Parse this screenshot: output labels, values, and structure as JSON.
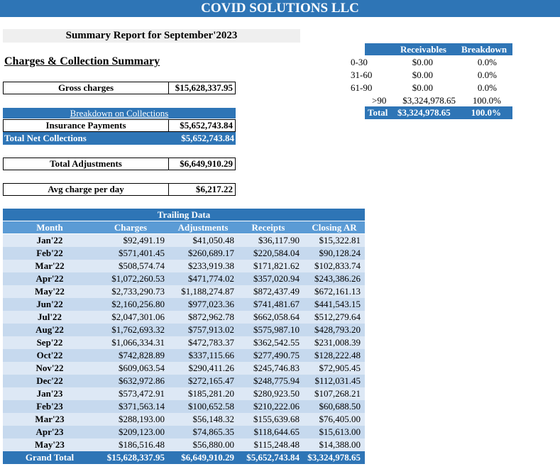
{
  "header": {
    "company": "COVID SOLUTIONS LLC"
  },
  "report_title": "Summary Report for September'2023",
  "section_title": "Charges & Collection Summary",
  "gross_charges": {
    "label": "Gross charges",
    "value": "$15,628,337.95"
  },
  "collections": {
    "header": "Breakdown on Collections",
    "insurance_label": "Insurance Payments",
    "insurance_value": "$5,652,743.84",
    "net_label": "Total Net Collections",
    "net_value": "$5,652,743.84"
  },
  "adjustments": {
    "label": "Total Adjustments",
    "value": "$6,649,910.29"
  },
  "avg_charge": {
    "label": "Avg charge per day",
    "value": "$6,217.22"
  },
  "receivables": {
    "header_title": "Receivables",
    "header_breakdown": "Breakdown",
    "rows": [
      {
        "bucket": "0-30",
        "amount": "$0.00",
        "pct": "0.0%"
      },
      {
        "bucket": "31-60",
        "amount": "$0.00",
        "pct": "0.0%"
      },
      {
        "bucket": "61-90",
        "amount": "$0.00",
        "pct": "0.0%"
      },
      {
        "bucket": ">90",
        "amount": "$3,324,978.65",
        "pct": "100.0%"
      }
    ],
    "total": {
      "label": "Total",
      "amount": "$3,324,978.65",
      "pct": "100.0%"
    }
  },
  "trailing": {
    "title": "Trailing Data",
    "columns": [
      "Month",
      "Charges",
      "Adjustments",
      "Receipts",
      "Closing AR"
    ],
    "rows": [
      [
        "Jan'22",
        "$92,491.19",
        "$41,050.48",
        "$36,117.90",
        "$15,322.81"
      ],
      [
        "Feb'22",
        "$571,401.45",
        "$260,689.17",
        "$220,584.04",
        "$90,128.24"
      ],
      [
        "Mar'22",
        "$508,574.74",
        "$233,919.38",
        "$171,821.62",
        "$102,833.74"
      ],
      [
        "Apr'22",
        "$1,072,260.53",
        "$471,774.02",
        "$357,020.94",
        "$243,386.26"
      ],
      [
        "May'22",
        "$2,733,290.73",
        "$1,188,274.87",
        "$872,437.49",
        "$672,161.13"
      ],
      [
        "Jun'22",
        "$2,160,256.80",
        "$977,023.36",
        "$741,481.67",
        "$441,543.15"
      ],
      [
        "Jul'22",
        "$2,047,301.06",
        "$872,962.78",
        "$662,058.64",
        "$512,279.64"
      ],
      [
        "Aug'22",
        "$1,762,693.32",
        "$757,913.02",
        "$575,987.10",
        "$428,793.20"
      ],
      [
        "Sep'22",
        "$1,066,334.31",
        "$472,783.37",
        "$362,542.55",
        "$231,008.39"
      ],
      [
        "Oct'22",
        "$742,828.89",
        "$337,115.66",
        "$277,490.75",
        "$128,222.48"
      ],
      [
        "Nov'22",
        "$609,063.54",
        "$290,411.26",
        "$245,746.83",
        "$72,905.45"
      ],
      [
        "Dec'22",
        "$632,972.86",
        "$272,165.47",
        "$248,775.94",
        "$112,031.45"
      ],
      [
        "Jan'23",
        "$573,472.91",
        "$185,281.20",
        "$280,923.50",
        "$107,268.21"
      ],
      [
        "Feb'23",
        "$371,563.14",
        "$100,652.58",
        "$210,222.06",
        "$60,688.50"
      ],
      [
        "Mar'23",
        "$288,193.00",
        "$56,148.32",
        "$155,639.68",
        "$76,405.00"
      ],
      [
        "Apr'23",
        "$209,123.00",
        "$74,865.35",
        "$118,644.65",
        "$15,613.00"
      ],
      [
        "May'23",
        "$186,516.48",
        "$56,880.00",
        "$115,248.48",
        "$14,388.00"
      ]
    ],
    "grand_total": [
      "Grand Total",
      "$15,628,337.95",
      "$6,649,910.29",
      "$5,652,743.84",
      "$3,324,978.65"
    ]
  }
}
